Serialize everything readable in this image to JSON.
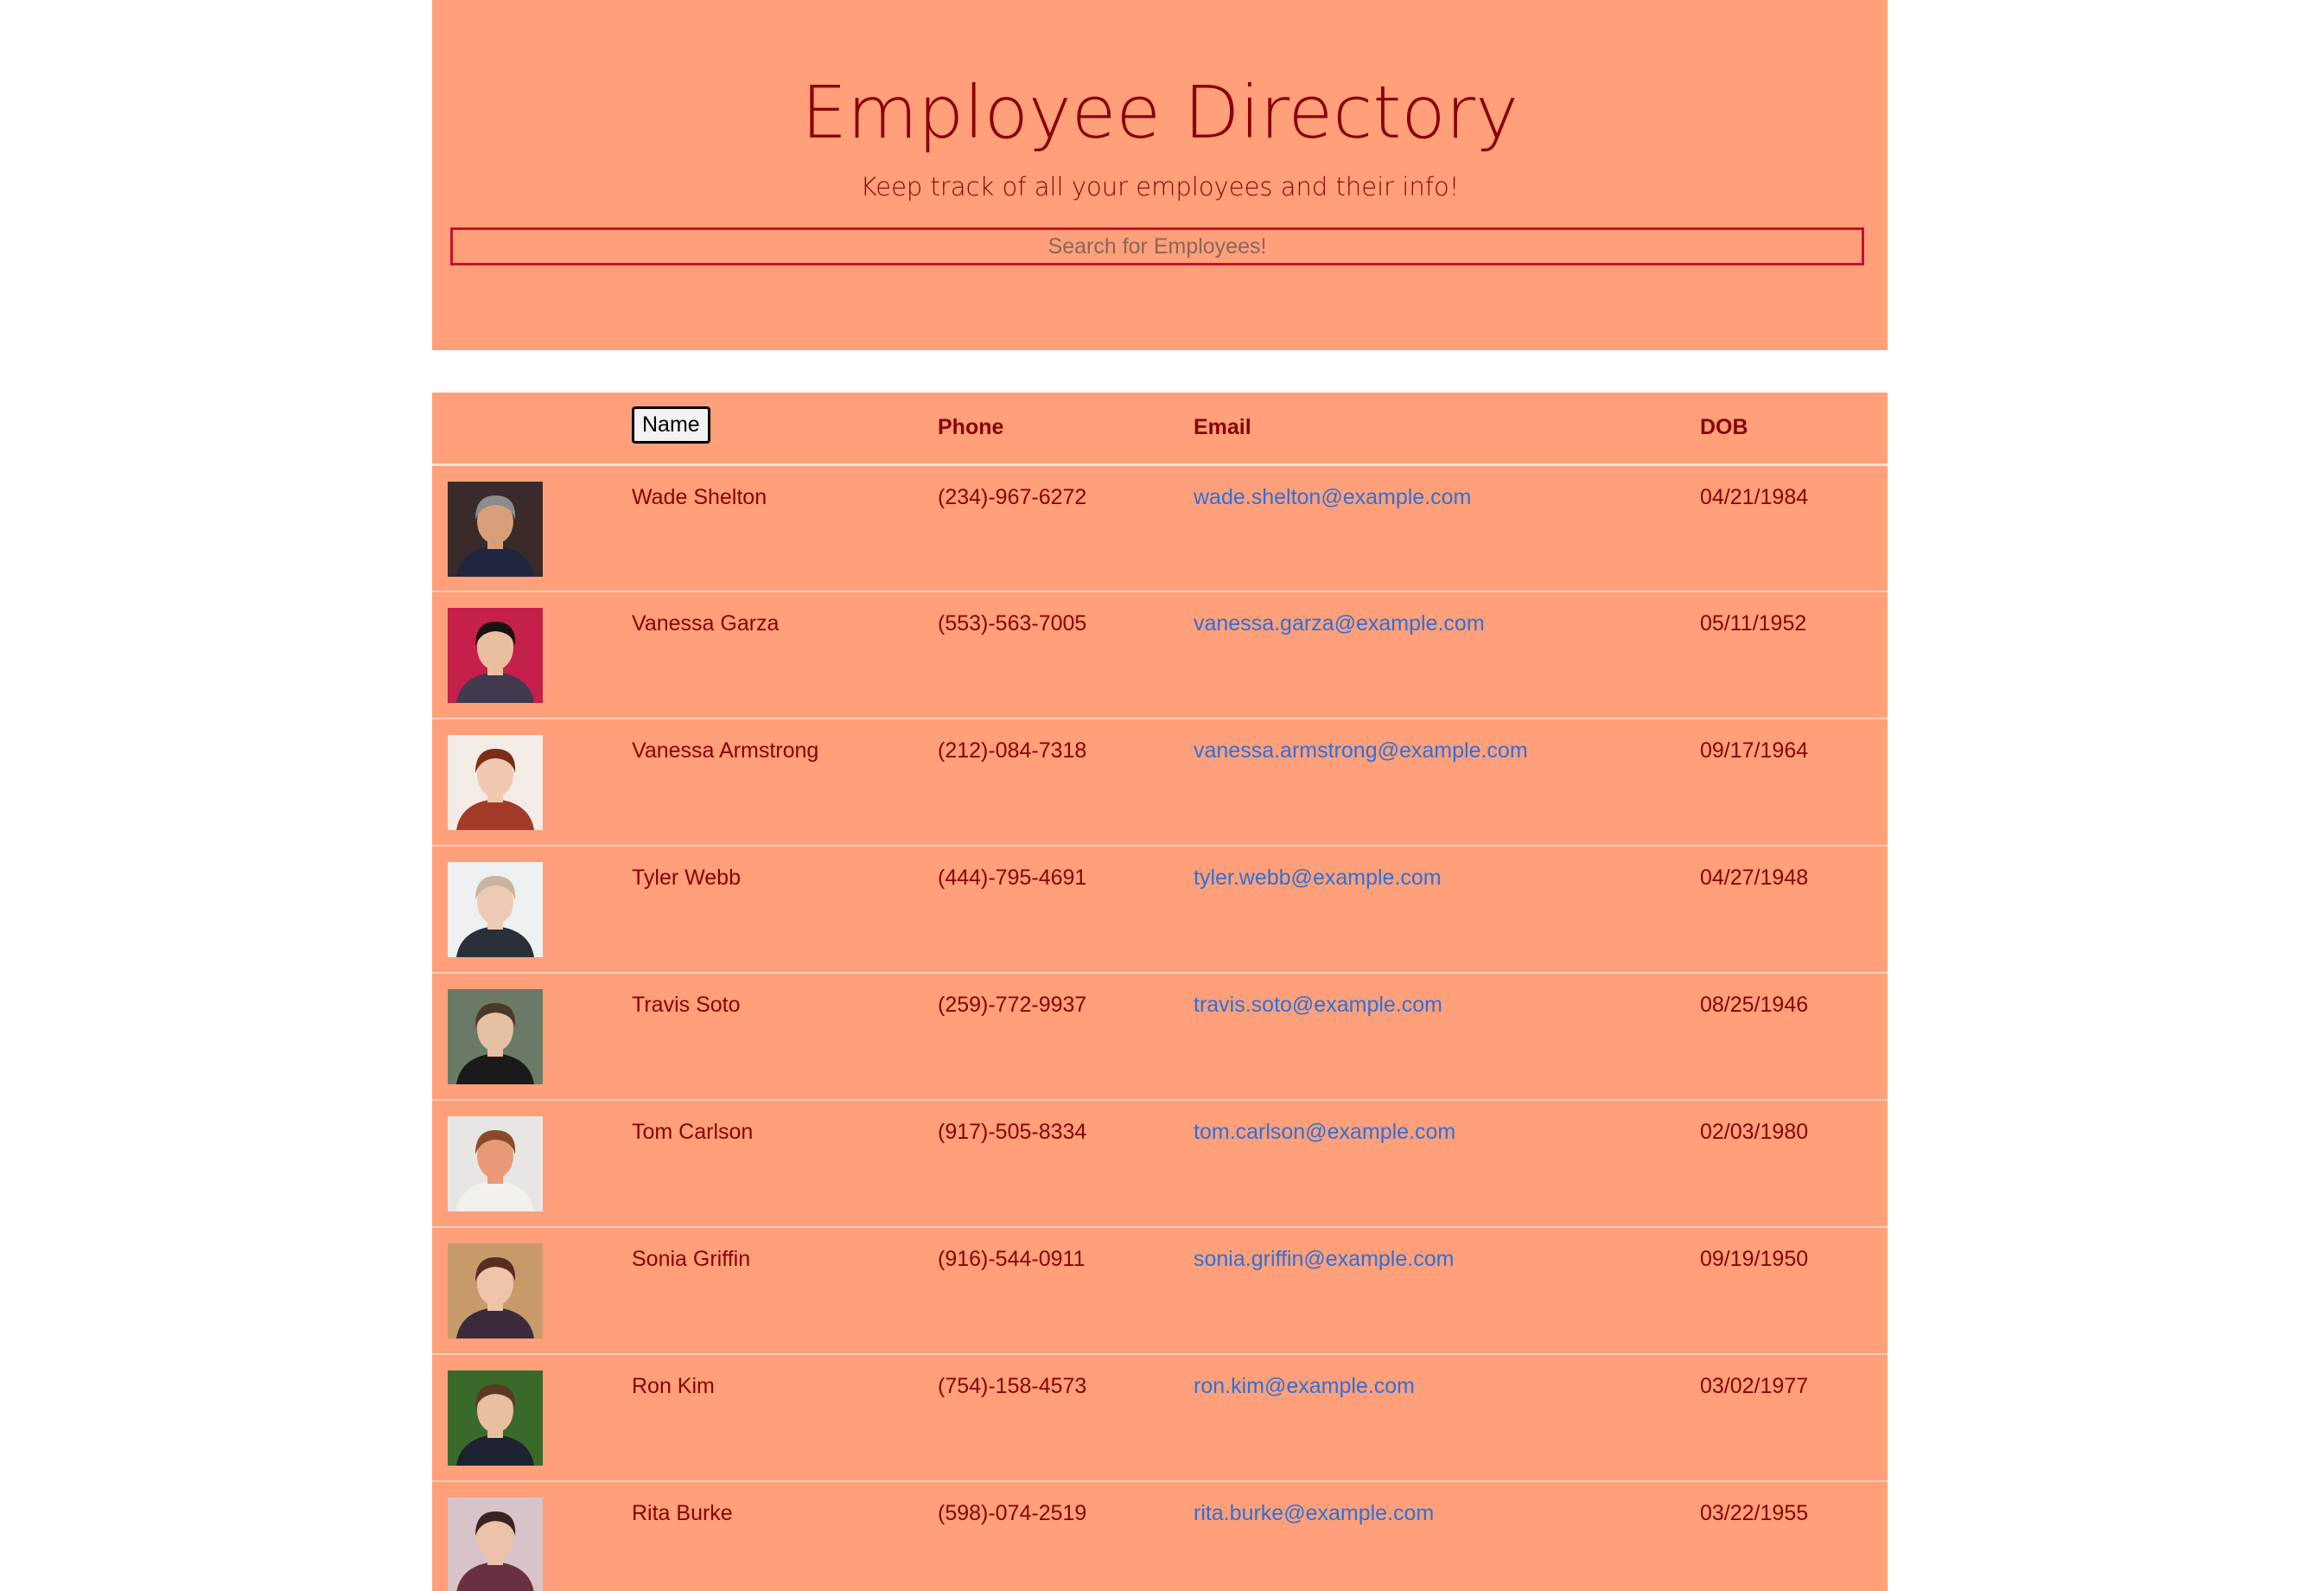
{
  "header": {
    "title": "Employee Directory",
    "subtitle": "Keep track of all your employees and their info!",
    "search_placeholder": "Search for Employees!"
  },
  "table": {
    "columns": {
      "image": "",
      "name": "Name",
      "phone": "Phone",
      "email": "Email",
      "dob": "DOB"
    },
    "rows": [
      {
        "name": "Wade Shelton",
        "phone": "(234)-967-6272",
        "email": "wade.shelton@example.com",
        "dob": "04/21/1984",
        "avatar_bg": "#3b2a2a",
        "avatar_face": "#d8a07a",
        "avatar_hair": "#8c8c8c",
        "avatar_cloth": "#1e2640"
      },
      {
        "name": "Vanessa Garza",
        "phone": "(553)-563-7005",
        "email": "vanessa.garza@example.com",
        "dob": "05/11/1952",
        "avatar_bg": "#c4204a",
        "avatar_face": "#e8c0a0",
        "avatar_hair": "#1a1212",
        "avatar_cloth": "#403a50"
      },
      {
        "name": "Vanessa Armstrong",
        "phone": "(212)-084-7318",
        "email": "vanessa.armstrong@example.com",
        "dob": "09/17/1964",
        "avatar_bg": "#f4ece6",
        "avatar_face": "#f0c8b0",
        "avatar_hair": "#7a2e18",
        "avatar_cloth": "#a33a2a"
      },
      {
        "name": "Tyler Webb",
        "phone": "(444)-795-4691",
        "email": "tyler.webb@example.com",
        "dob": "04/27/1948",
        "avatar_bg": "#eef0f2",
        "avatar_face": "#eecab4",
        "avatar_hair": "#c8b4a0",
        "avatar_cloth": "#2a3038"
      },
      {
        "name": "Travis Soto",
        "phone": "(259)-772-9937",
        "email": "travis.soto@example.com",
        "dob": "08/25/1946",
        "avatar_bg": "#6a7a66",
        "avatar_face": "#e6c0a4",
        "avatar_hair": "#4a3828",
        "avatar_cloth": "#1a1a1a"
      },
      {
        "name": "Tom Carlson",
        "phone": "(917)-505-8334",
        "email": "tom.carlson@example.com",
        "dob": "02/03/1980",
        "avatar_bg": "#e8e6e4",
        "avatar_face": "#e89a78",
        "avatar_hair": "#8a4a2a",
        "avatar_cloth": "#f4f0ec"
      },
      {
        "name": "Sonia Griffin",
        "phone": "(916)-544-0911",
        "email": "sonia.griffin@example.com",
        "dob": "09/19/1950",
        "avatar_bg": "#c89a6a",
        "avatar_face": "#f0c4a8",
        "avatar_hair": "#5a2a24",
        "avatar_cloth": "#3a2a3a"
      },
      {
        "name": "Ron Kim",
        "phone": "(754)-158-4573",
        "email": "ron.kim@example.com",
        "dob": "03/02/1977",
        "avatar_bg": "#3a6a2a",
        "avatar_face": "#e8c0a0",
        "avatar_hair": "#5a3a22",
        "avatar_cloth": "#1e2230"
      },
      {
        "name": "Rita Burke",
        "phone": "(598)-074-2519",
        "email": "rita.burke@example.com",
        "dob": "03/22/1955",
        "avatar_bg": "#d8c4c8",
        "avatar_face": "#ecc2a8",
        "avatar_hair": "#3a2420",
        "avatar_cloth": "#6a3040"
      }
    ]
  },
  "colors": {
    "background": "#ffa07a",
    "title_text": "#8b0000",
    "link": "#2f6fd8",
    "search_border": "#c8102e"
  }
}
